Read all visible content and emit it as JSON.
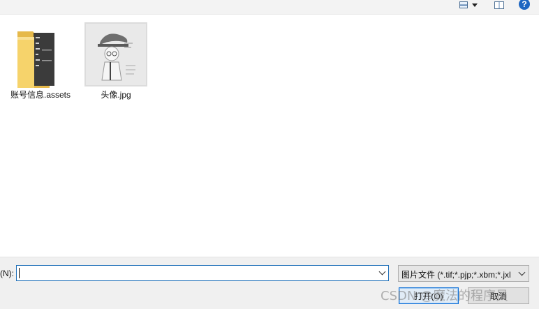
{
  "toolbar": {
    "view_icon": "view-options-icon",
    "pane_icon": "preview-pane-icon",
    "help_label": "?"
  },
  "files": [
    {
      "name": "账号信息.assets",
      "type": "folder"
    },
    {
      "name": "头像.jpg",
      "type": "image"
    }
  ],
  "bottom": {
    "filename_label": "(N):",
    "filename_value": "",
    "filter_value": "图片文件 (*.tif;*.pjp;*.xbm;*.jxl",
    "open_label": "打开(O)",
    "cancel_label": "取消"
  },
  "watermark": "CSDN @魔法的程序员",
  "colors": {
    "accent": "#1f6fb8",
    "help_blue": "#1f67c1",
    "folder_yellow": "#f6d36b"
  }
}
